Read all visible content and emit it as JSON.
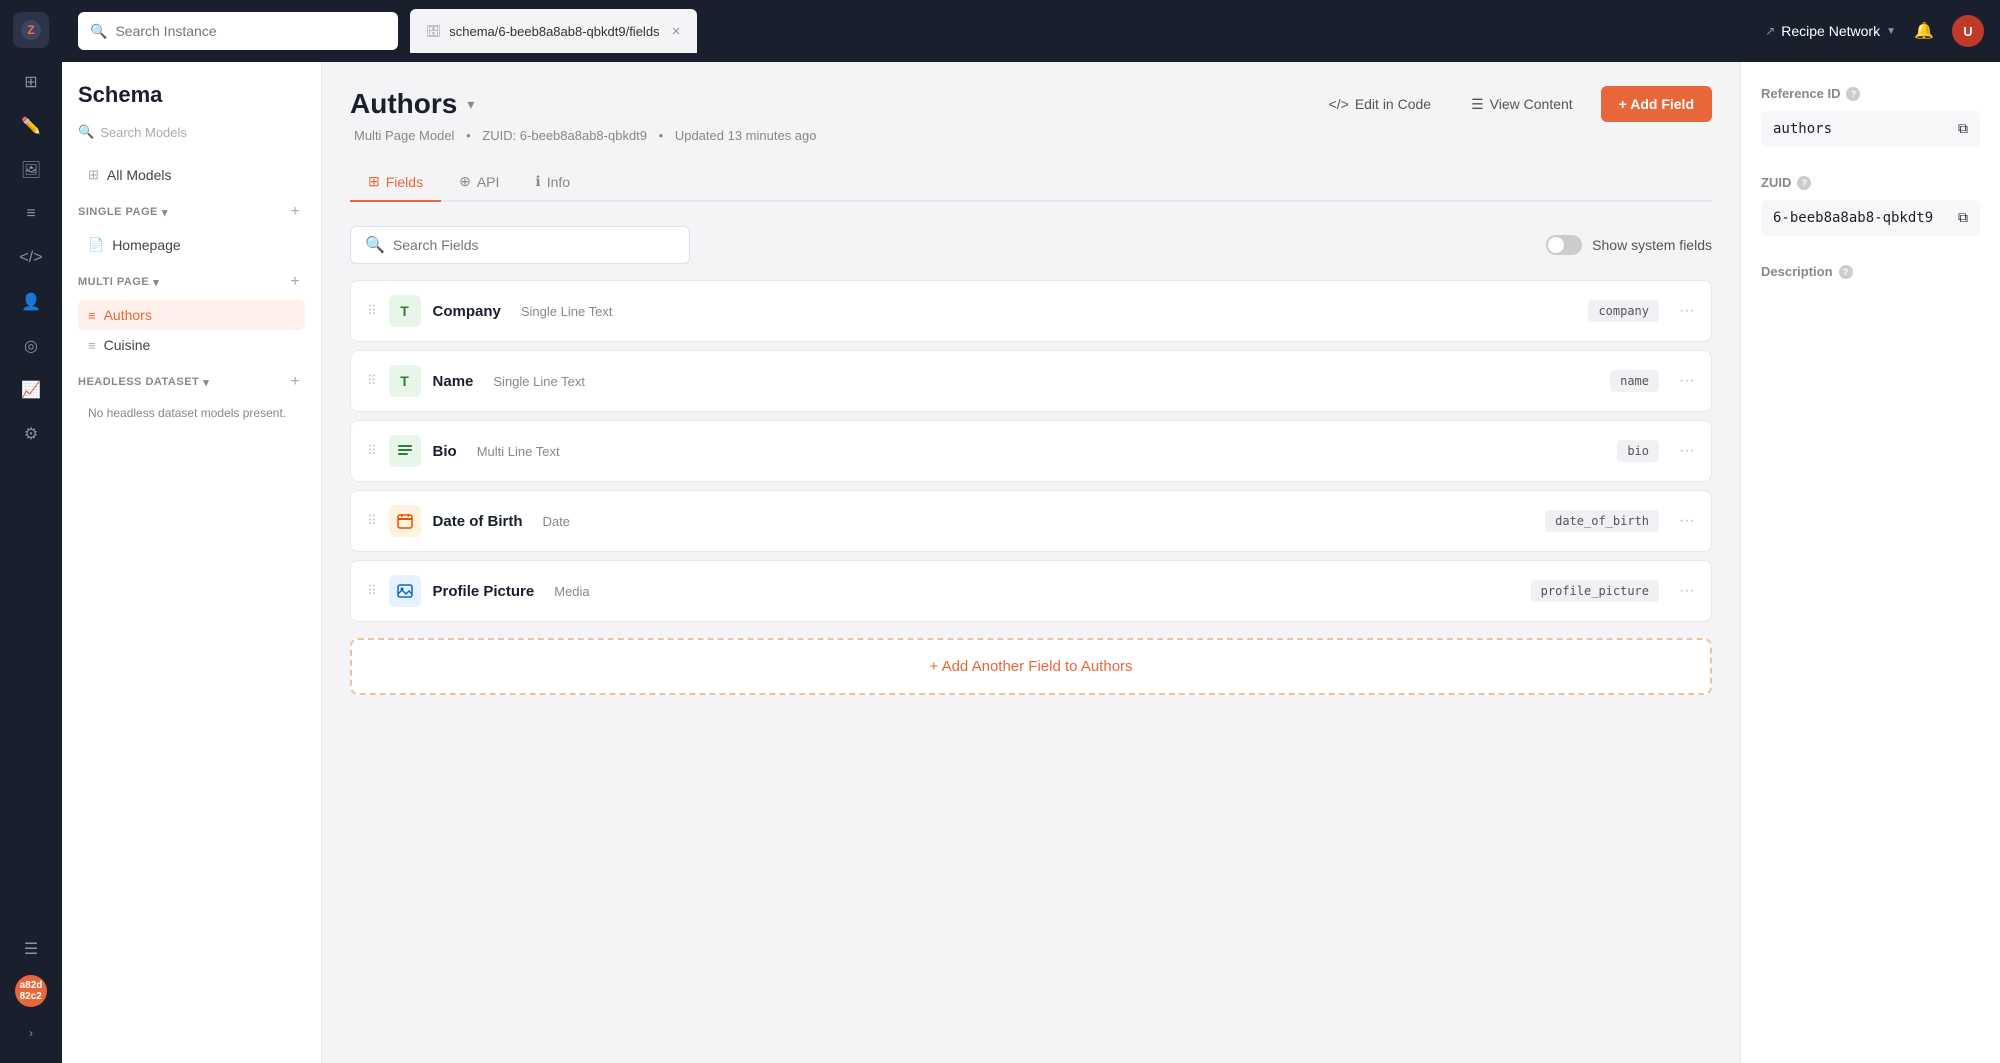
{
  "app": {
    "logo_text": "Z"
  },
  "topbar": {
    "search_placeholder": "Search Instance",
    "tab_label": "schema/6-beeb8a8ab8-qbkdt9/fields",
    "recipe_network": "Recipe Network",
    "user_code": "U"
  },
  "sidebar": {
    "title": "Schema",
    "search_placeholder": "Search Models",
    "all_models_label": "All Models",
    "sections": [
      {
        "label": "SINGLE PAGE",
        "items": [
          {
            "name": "Homepage",
            "icon": "📄"
          }
        ]
      },
      {
        "label": "MULTI PAGE",
        "items": [
          {
            "name": "Authors",
            "icon": "≡",
            "active": true
          },
          {
            "name": "Cuisine",
            "icon": "≡"
          }
        ]
      },
      {
        "label": "HEADLESS DATASET",
        "items": [],
        "empty_text": "No headless dataset models present."
      }
    ]
  },
  "model": {
    "title": "Authors",
    "subtitle_type": "Multi Page Model",
    "subtitle_bullet": "•",
    "subtitle_zuid": "ZUID: 6-beeb8a8ab8-qbkdt9",
    "subtitle_updated": "Updated 13 minutes ago"
  },
  "header_actions": {
    "edit_in_code": "Edit in Code",
    "view_content": "View Content",
    "add_field": "+ Add Field"
  },
  "tabs": [
    {
      "id": "fields",
      "label": "Fields",
      "active": true,
      "icon": "⊞"
    },
    {
      "id": "api",
      "label": "API",
      "active": false,
      "icon": "⊕"
    },
    {
      "id": "info",
      "label": "Info",
      "active": false,
      "icon": "ℹ"
    }
  ],
  "fields_toolbar": {
    "search_placeholder": "Search Fields",
    "toggle_label": "Show system fields"
  },
  "fields": [
    {
      "id": "company",
      "name": "Company",
      "type": "Single Line Text",
      "type_key": "text",
      "ref": "company"
    },
    {
      "id": "name",
      "name": "Name",
      "type": "Single Line Text",
      "type_key": "text",
      "ref": "name"
    },
    {
      "id": "bio",
      "name": "Bio",
      "type": "Multi Line Text",
      "type_key": "multitext",
      "ref": "bio"
    },
    {
      "id": "dob",
      "name": "Date of Birth",
      "type": "Date",
      "type_key": "date",
      "ref": "date_of_birth"
    },
    {
      "id": "profile",
      "name": "Profile Picture",
      "type": "Media",
      "type_key": "media",
      "ref": "profile_picture"
    }
  ],
  "add_field_label": "+ Add Another Field to Authors",
  "right_panel": {
    "reference_id_label": "Reference ID",
    "reference_id_value": "authors",
    "uuid_label": "ZUID",
    "uuid_value": "6-beeb8a8ab8-qbkdt9",
    "description_label": "Description"
  }
}
